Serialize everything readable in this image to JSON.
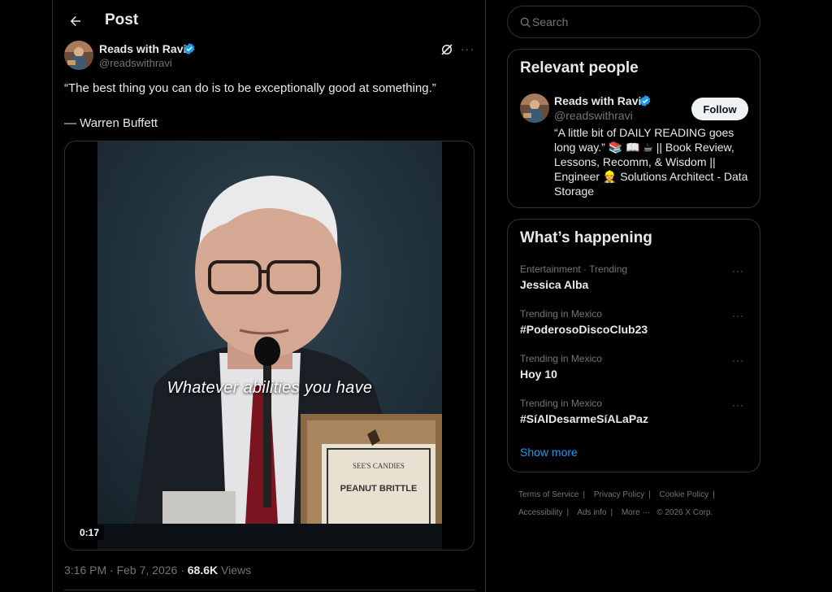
{
  "header": {
    "title": "Post",
    "back_icon": "arrow-left-icon"
  },
  "post": {
    "author_name": "Reads with Ravi",
    "author_handle": "@readswithravi",
    "text": "“The best thing you can do is to be exceptionally good at something.”",
    "attribution": "— Warren Buffett",
    "video_caption": "Whatever abilities you have",
    "video_duration": "0:17",
    "timestamp": "3:16 PM · Feb 7, 2026 · ",
    "views_count": "68.6K",
    "views_label": " Views"
  },
  "search": {
    "placeholder": "Search"
  },
  "relevant_people": {
    "title": "Relevant people",
    "person": {
      "name": "Reads with Ravi",
      "handle": "@readswithravi",
      "follow_label": "Follow",
      "bio": "“A little bit of DAILY READING goes long way.” 📚 📖 ☕ || Book Review, Lessons, Recomm, & Wisdom || Engineer 👷 Solutions Architect - Data Storage"
    }
  },
  "whats_happening": {
    "title": "What’s happening",
    "trends": [
      {
        "context": "Entertainment · Trending",
        "name": "Jessica Alba"
      },
      {
        "context": "Trending in Mexico",
        "name": "#PoderosoDiscoClub23"
      },
      {
        "context": "Trending in Mexico",
        "name": "Hoy 10"
      },
      {
        "context": "Trending in Mexico",
        "name": "#SíAlDesarmeSíALaPaz"
      }
    ],
    "show_more": "Show more"
  },
  "footer": {
    "links": [
      "Terms of Service",
      "Privacy Policy",
      "Cookie Policy",
      "Accessibility",
      "Ads info",
      "More ···",
      "© 2026 X Corp."
    ]
  },
  "colors": {
    "accent": "#1d9bf0",
    "background": "#000000",
    "border": "#2f3336",
    "muted": "#71767b"
  }
}
